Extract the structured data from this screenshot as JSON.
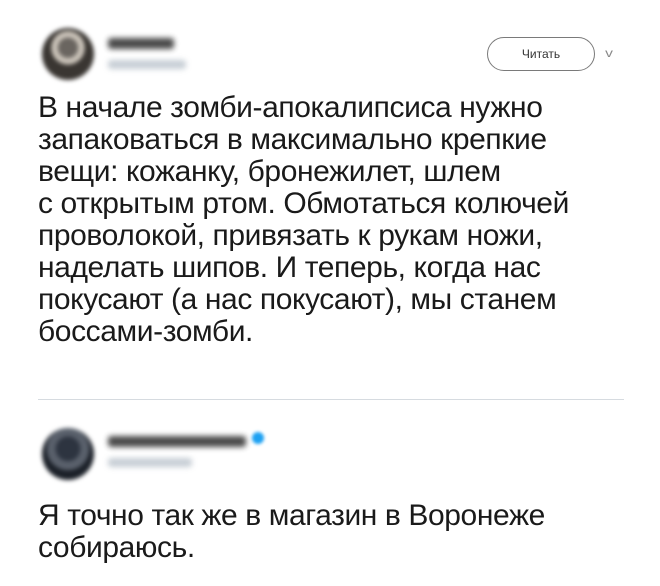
{
  "tweets": [
    {
      "follow_button": "Читать",
      "text": "В начале зомби-апокалипсиса нужно\nзапаковаться в максимально крепкие\nвещи: кожанку, бронежилет, шлем\nс открытым ртом. Обмотаться колючей\nпроволокой, привязать к рукам ножи,\nнаделать шипов. И теперь, когда нас\nпокусают (а нас покусают), мы станем\nбоссами-зомби."
    },
    {
      "text": "Я точно так же в магазин в Воронеже\nсобираюсь."
    }
  ],
  "icons": {
    "chevron": "chevron-down-icon",
    "verified": "verified-badge-icon"
  },
  "colors": {
    "verified": "#1da1f2",
    "divider": "#d6dbe0"
  }
}
